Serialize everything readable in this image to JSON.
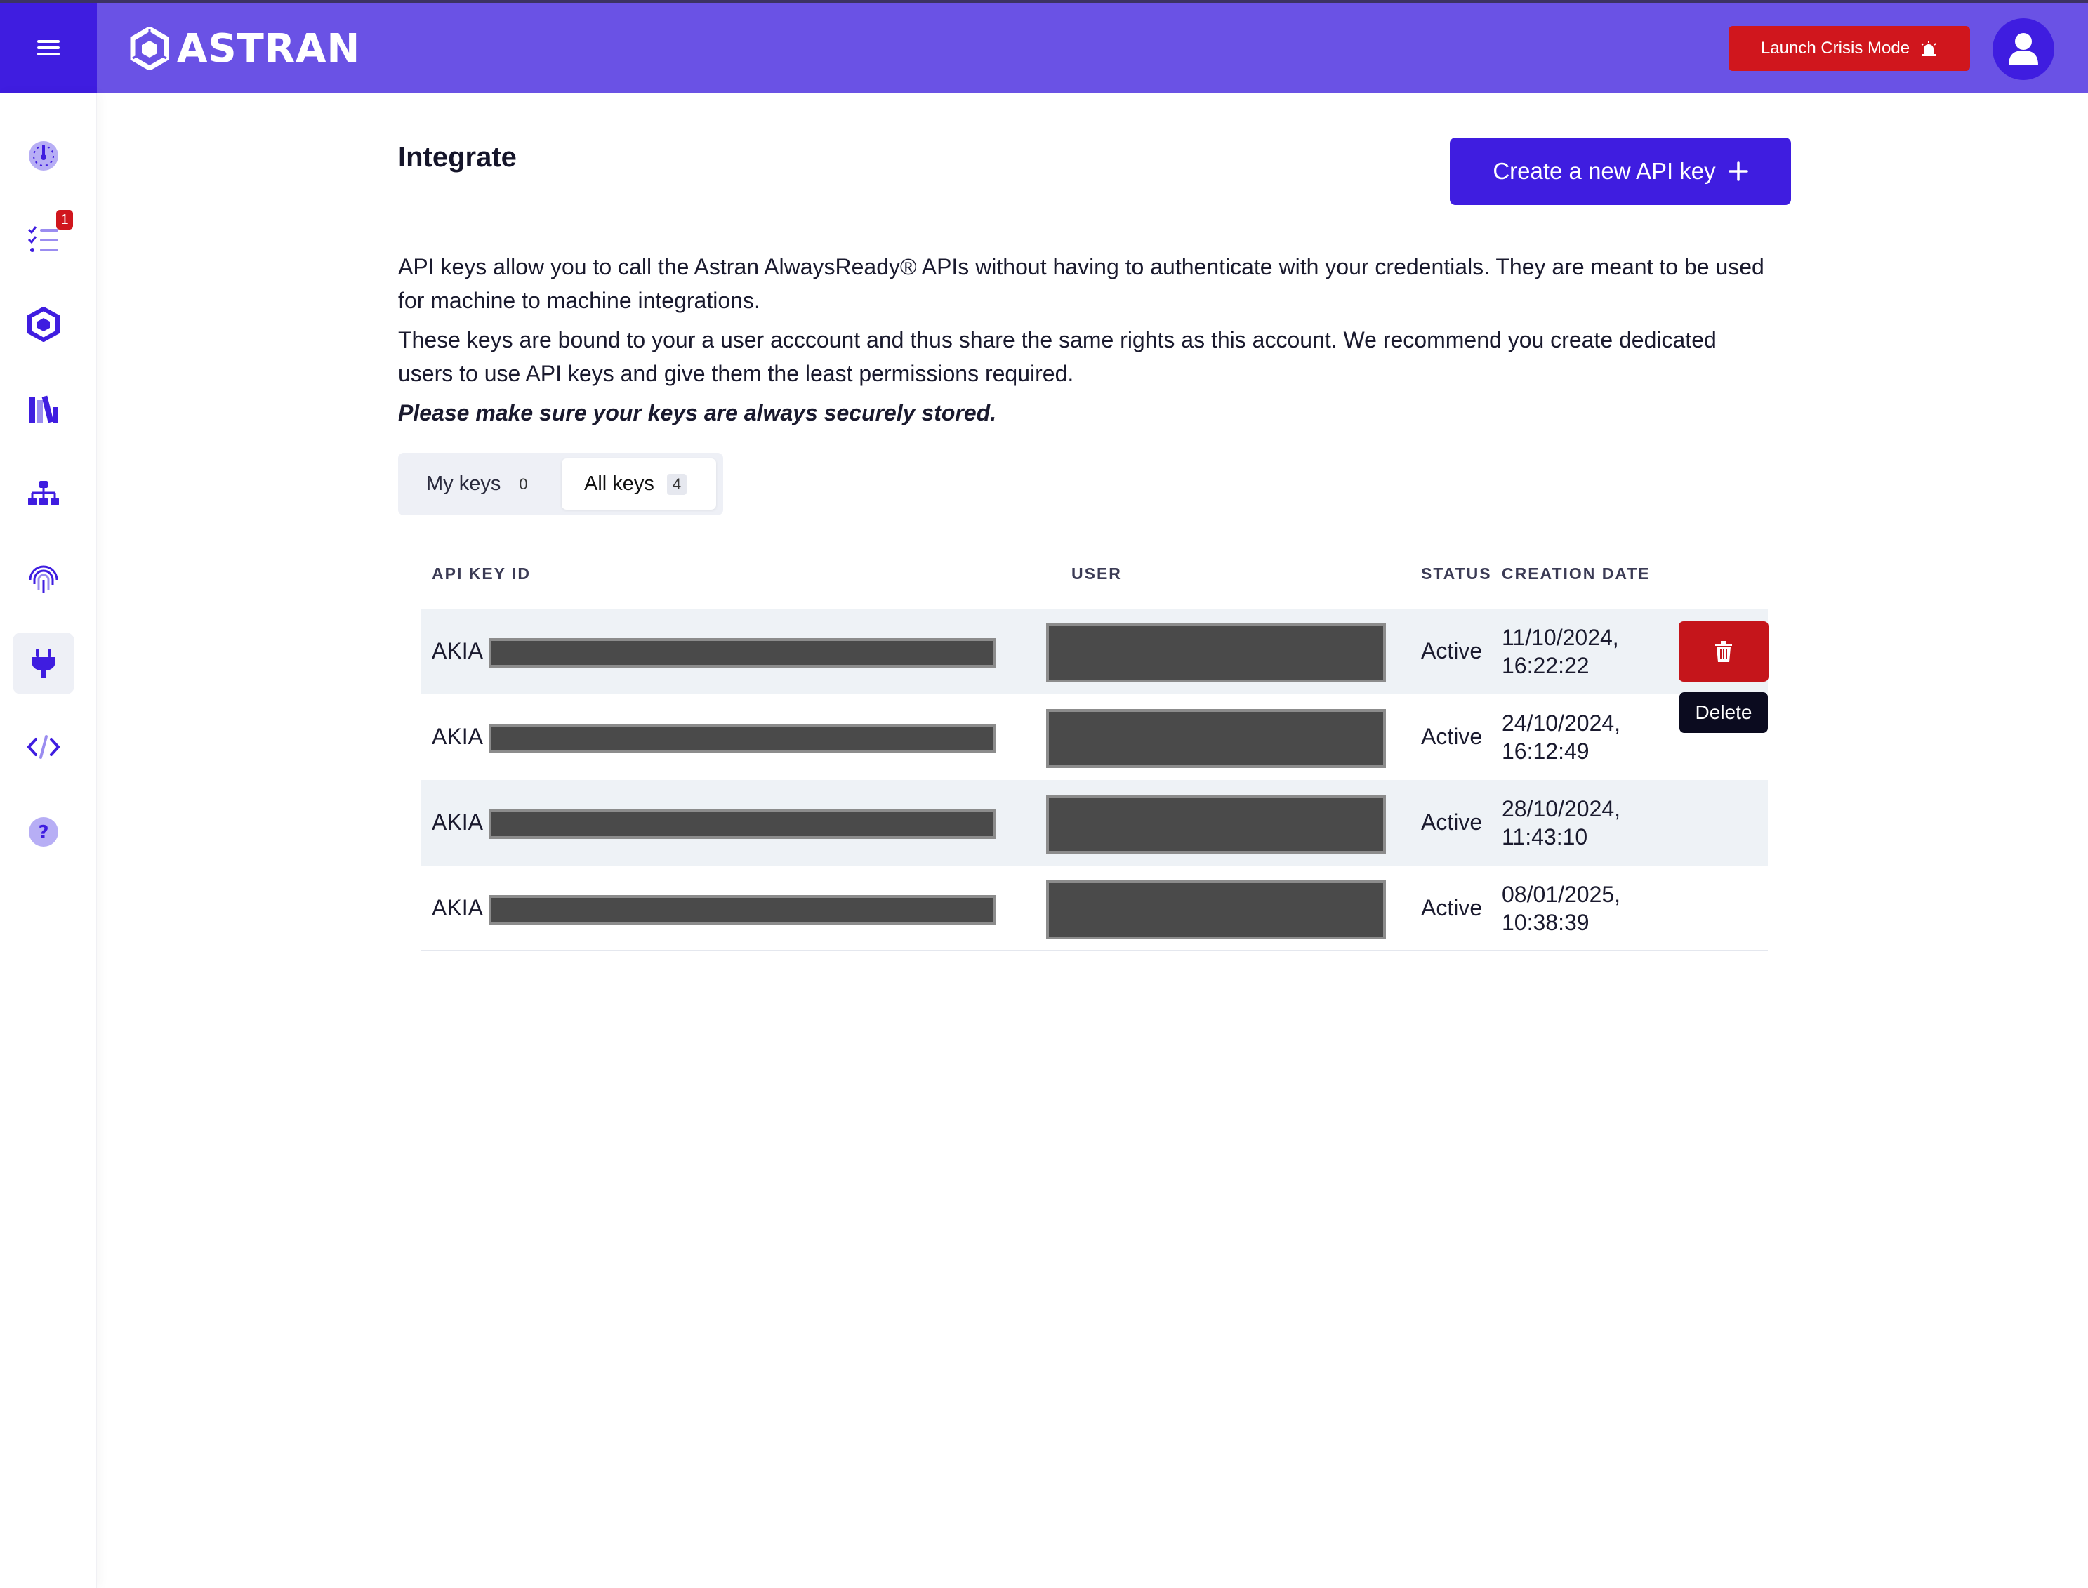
{
  "header": {
    "logo_text": "ASTRAN",
    "crisis_button": "Launch Crisis Mode",
    "accent_color": "#6a52e5",
    "primary_color": "#3f1de0",
    "danger_color": "#d0161d"
  },
  "sidebar": {
    "items": [
      {
        "icon": "dashboard-gauge-icon"
      },
      {
        "icon": "task-list-icon",
        "badge": "1"
      },
      {
        "icon": "astran-cube-icon"
      },
      {
        "icon": "library-books-icon"
      },
      {
        "icon": "hierarchy-sitemap-icon"
      },
      {
        "icon": "fingerprint-icon"
      },
      {
        "icon": "plug-integration-icon",
        "active": true
      },
      {
        "icon": "code-brackets-icon"
      },
      {
        "icon": "help-question-icon"
      }
    ]
  },
  "page": {
    "title": "Integrate",
    "create_button": "Create a new API key",
    "description_1": "API keys allow you to call the Astran AlwaysReady® APIs without having to authenticate with your credentials. They are meant to be used for machine to machine integrations.",
    "description_2": "These keys are bound to your a user acccount and thus share the same rights as this account. We recommend you create dedicated users to use API keys and give them the least permissions required.",
    "description_3": "Please make sure your keys are always securely stored."
  },
  "tabs": [
    {
      "label": "My keys",
      "count": "0",
      "selected": false
    },
    {
      "label": "All keys",
      "count": "4",
      "selected": true
    }
  ],
  "table": {
    "columns": [
      "API KEY ID",
      "USER",
      "STATUS",
      "CREATION DATE"
    ],
    "rows": [
      {
        "key_prefix": "AKIA",
        "status": "Active",
        "date_line1": "11/10/2024,",
        "date_line2": "16:22:22"
      },
      {
        "key_prefix": "AKIA",
        "status": "Active",
        "date_line1": "24/10/2024,",
        "date_line2": "16:12:49"
      },
      {
        "key_prefix": "AKIA",
        "status": "Active",
        "date_line1": "28/10/2024,",
        "date_line2": "11:43:10"
      },
      {
        "key_prefix": "AKIA",
        "status": "Active",
        "date_line1": "08/01/2025,",
        "date_line2": "10:38:39"
      }
    ],
    "delete_tooltip": "Delete"
  }
}
